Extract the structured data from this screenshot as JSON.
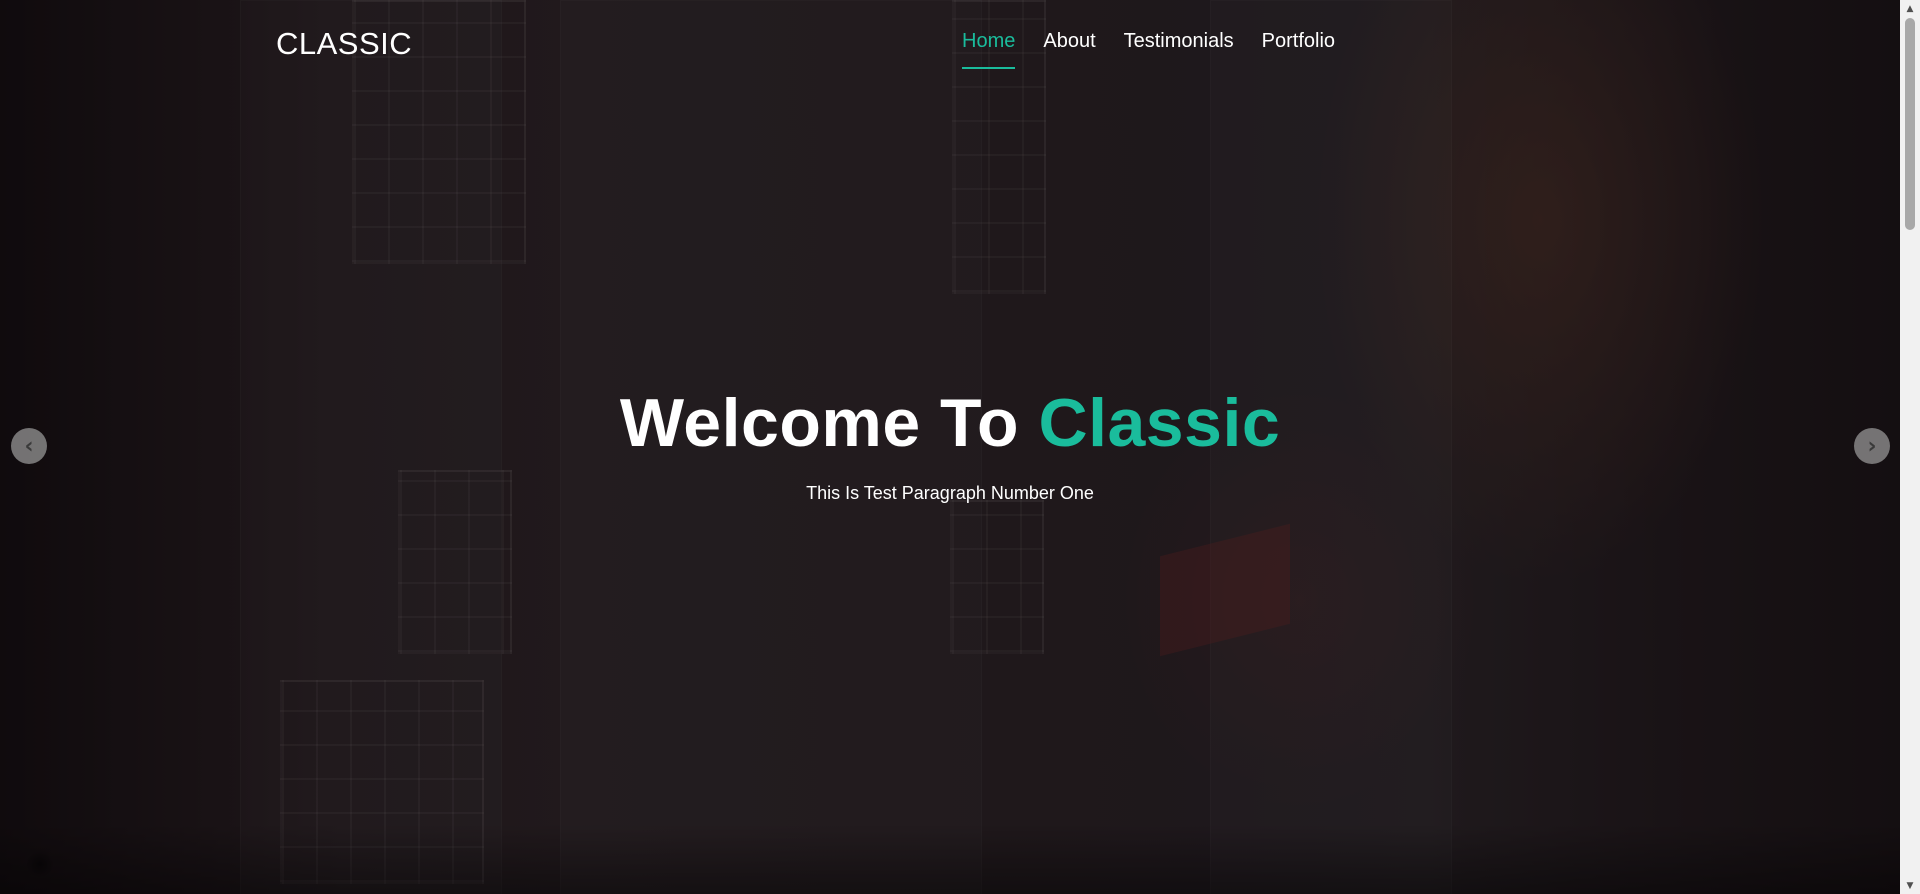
{
  "brand": {
    "name": "CLASSIC"
  },
  "nav": {
    "items": [
      {
        "label": "Home",
        "active": true
      },
      {
        "label": "About",
        "active": false
      },
      {
        "label": "Testimonials",
        "active": false
      },
      {
        "label": "Portfolio",
        "active": false
      }
    ]
  },
  "hero": {
    "title_prefix": "Welcome To",
    "title_accent": "Classic",
    "subtitle": "This Is Test Paragraph Number One"
  },
  "carousel": {
    "prev_icon": "chevron-left-icon",
    "next_icon": "chevron-right-icon"
  },
  "colors": {
    "accent": "#1abc9c",
    "text": "#ffffff",
    "background": "#2b2225"
  },
  "icons": {
    "scroll_up": "triangle-up-icon",
    "scroll_down": "triangle-down-icon"
  }
}
